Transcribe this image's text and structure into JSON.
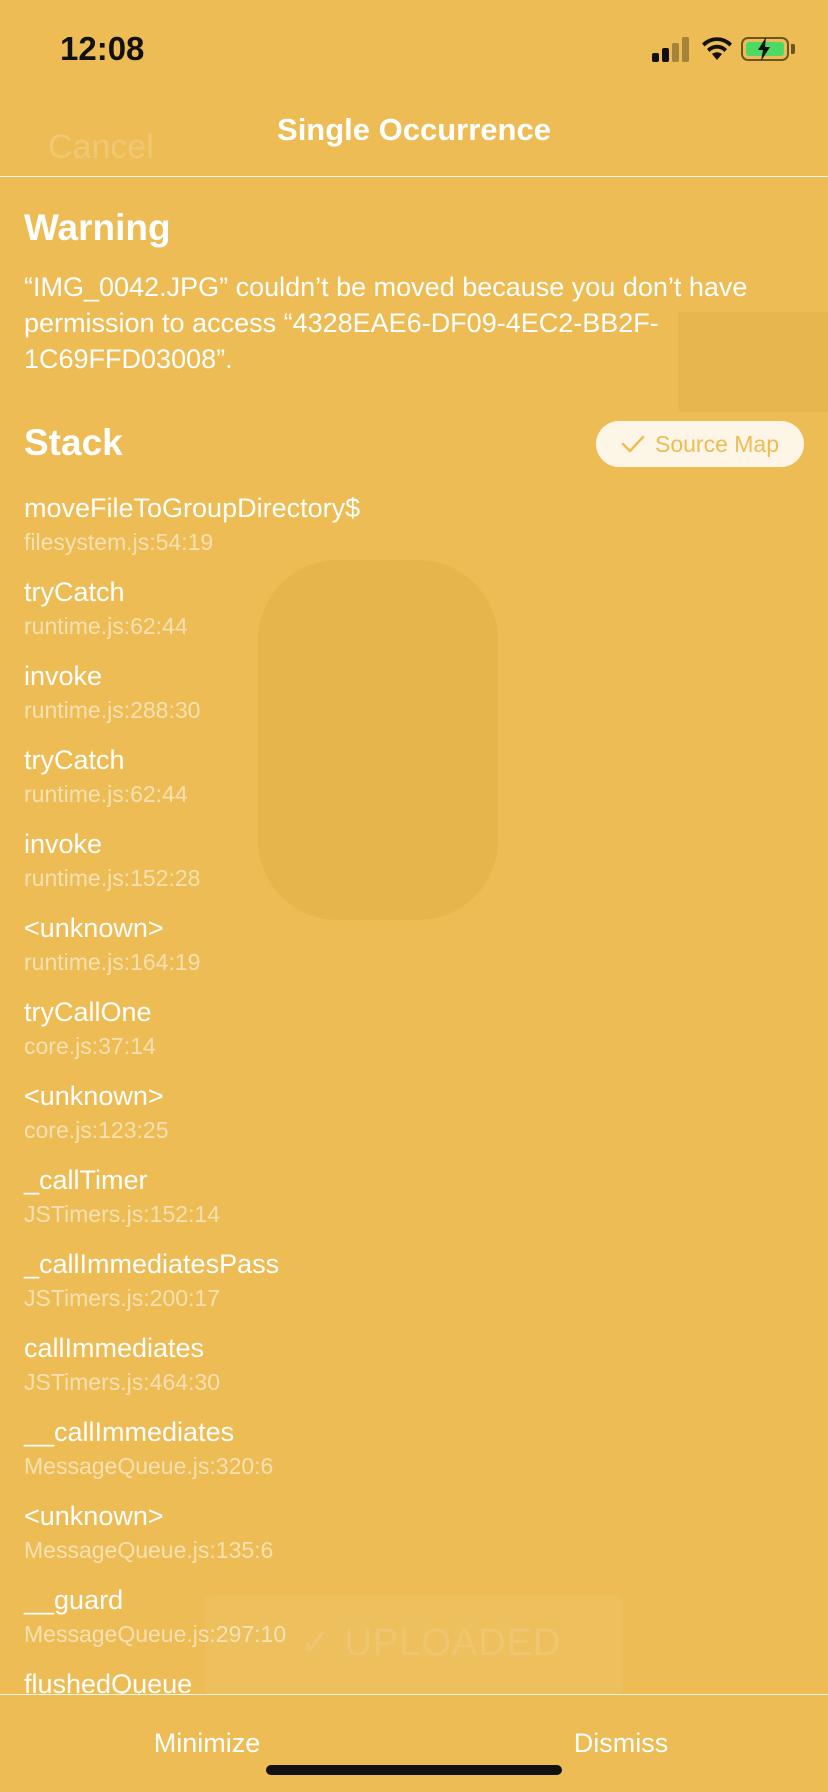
{
  "status_bar": {
    "time": "12:08",
    "icons": [
      "cellular-signal-icon",
      "wifi-icon",
      "battery-charging-icon"
    ]
  },
  "background": {
    "cancel_label": "Cancel",
    "upload_label": "✓ UPLOADED"
  },
  "header": {
    "title": "Single Occurrence"
  },
  "warning": {
    "heading": "Warning",
    "message": "“IMG_0042.JPG” couldn’t be moved because you don’t have permission to access “4328EAE6-DF09-4EC2-BB2F-1C69FFD03008”."
  },
  "stack": {
    "heading": "Stack",
    "source_map_label": "Source Map",
    "frames": [
      {
        "name": "moveFileToGroupDirectory$",
        "location": "filesystem.js:54:19"
      },
      {
        "name": "tryCatch",
        "location": "runtime.js:62:44"
      },
      {
        "name": "invoke",
        "location": "runtime.js:288:30"
      },
      {
        "name": "tryCatch",
        "location": "runtime.js:62:44"
      },
      {
        "name": "invoke",
        "location": "runtime.js:152:28"
      },
      {
        "name": "<unknown>",
        "location": "runtime.js:164:19"
      },
      {
        "name": "tryCallOne",
        "location": "core.js:37:14"
      },
      {
        "name": "<unknown>",
        "location": "core.js:123:25"
      },
      {
        "name": "_callTimer",
        "location": "JSTimers.js:152:14"
      },
      {
        "name": "_callImmediatesPass",
        "location": "JSTimers.js:200:17"
      },
      {
        "name": "callImmediates",
        "location": "JSTimers.js:464:30"
      },
      {
        "name": "__callImmediates",
        "location": "MessageQueue.js:320:6"
      },
      {
        "name": "<unknown>",
        "location": "MessageQueue.js:135:6"
      },
      {
        "name": "__guard",
        "location": "MessageQueue.js:297:10"
      },
      {
        "name": "flushedQueue",
        "location": ""
      }
    ]
  },
  "footer": {
    "minimize_label": "Minimize",
    "dismiss_label": "Dismiss"
  },
  "colors": {
    "background": "#EDBC55",
    "text": "#FFFFFF",
    "battery_fill": "#4CD964"
  }
}
